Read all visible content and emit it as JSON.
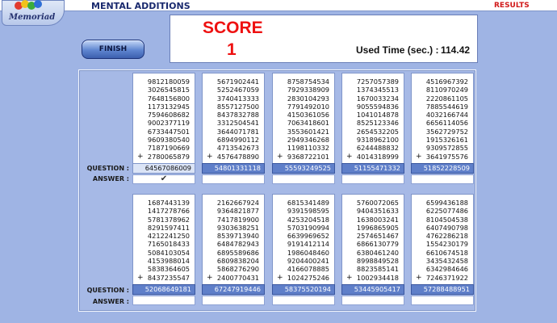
{
  "app": {
    "title": "MENTAL ADDITIONS",
    "results_label": "RESULTS",
    "logo_text": "Memoriad"
  },
  "toolbar": {
    "finish_label": "FINISH"
  },
  "score": {
    "label": "SCORE",
    "value": "1",
    "time_label": "Used Time (sec.) :",
    "time_value": "114.42"
  },
  "labels": {
    "question": "QUESTION :",
    "answer": "ANSWER :",
    "plus": "+"
  },
  "rows": [
    {
      "columns": [
        {
          "numbers": [
            "9812180059",
            "3026545815",
            "7648156800",
            "1173132945",
            "7594608682",
            "9002377119",
            "6733447501",
            "9609380540",
            "7187190669",
            "2780065879"
          ],
          "question": "64567086009",
          "answer": "✔"
        },
        {
          "numbers": [
            "5671902441",
            "5252467059",
            "3740413333",
            "8557127500",
            "8437832788",
            "3312504541",
            "3644071781",
            "6894990112",
            "4713542673",
            "4576478890"
          ],
          "question": "54801331118",
          "answer": ""
        },
        {
          "numbers": [
            "8758754534",
            "7929338909",
            "2830104293",
            "7791492010",
            "4150361056",
            "7063418601",
            "3553601421",
            "2949346268",
            "1198110332",
            "9368722101"
          ],
          "question": "55593249525",
          "answer": ""
        },
        {
          "numbers": [
            "7257057389",
            "1374345513",
            "1670033234",
            "9055594836",
            "1041014878",
            "8525123346",
            "2654532205",
            "9318962100",
            "6244488832",
            "4014318999"
          ],
          "question": "51155471332",
          "answer": ""
        },
        {
          "numbers": [
            "4516967392",
            "8110970249",
            "2220861105",
            "7885544619",
            "4032166744",
            "6656114056",
            "3562729752",
            "1915326161",
            "9309572855",
            "3641975576"
          ],
          "question": "51852228509",
          "answer": ""
        }
      ]
    },
    {
      "columns": [
        {
          "numbers": [
            "1687443139",
            "1417278766",
            "5781378962",
            "8291597411",
            "4212241250",
            "7165018433",
            "5084103054",
            "4153988014",
            "5838364605",
            "8437235547"
          ],
          "question": "52068649181",
          "answer": ""
        },
        {
          "numbers": [
            "2162667924",
            "9364821877",
            "7417819900",
            "9303638251",
            "8539713940",
            "6484782943",
            "6895589686",
            "6809838204",
            "5868276290",
            "2400770431"
          ],
          "question": "67247919446",
          "answer": ""
        },
        {
          "numbers": [
            "6815341489",
            "9391598595",
            "4253204518",
            "5703190994",
            "6639969652",
            "9191412114",
            "1986048460",
            "9204400241",
            "4166078885",
            "1024275246"
          ],
          "question": "58375520194",
          "answer": ""
        },
        {
          "numbers": [
            "5760072065",
            "9404351633",
            "1638003241",
            "1996865905",
            "2574651467",
            "6866130779",
            "6380461240",
            "8998849528",
            "8823585141",
            "1002934418"
          ],
          "question": "53445905417",
          "answer": ""
        },
        {
          "numbers": [
            "6599436188",
            "6225077486",
            "8104504538",
            "6407490798",
            "4762286218",
            "1554230179",
            "6610674518",
            "3435432458",
            "6342984646",
            "7246371922"
          ],
          "question": "57288488951",
          "answer": ""
        }
      ]
    }
  ]
}
